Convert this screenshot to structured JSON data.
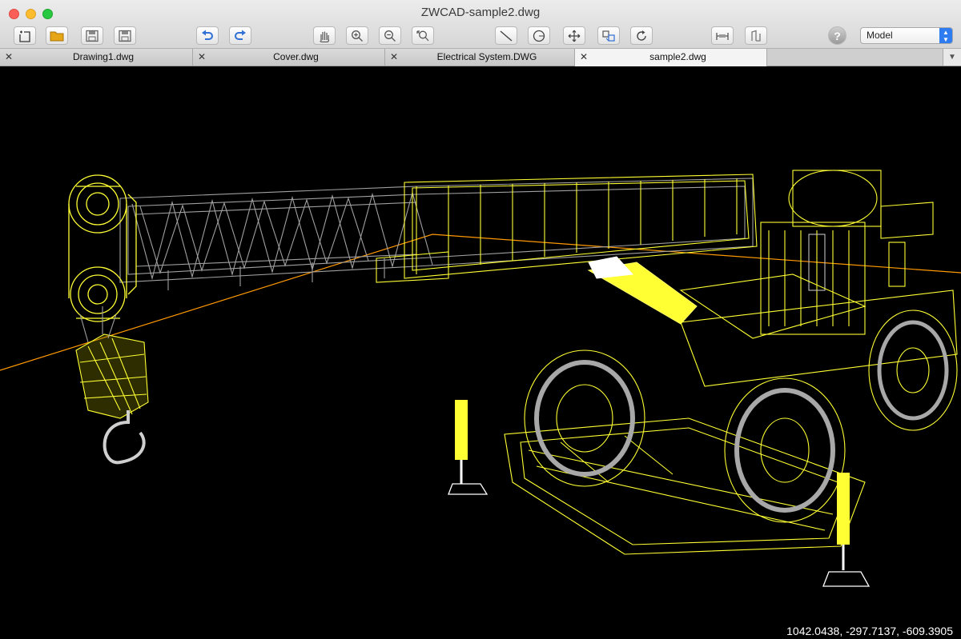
{
  "window": {
    "title": "ZWCAD-sample2.dwg"
  },
  "toolbar": {
    "buttons": [
      {
        "name": "new-drawing",
        "icon": "new-file-icon"
      },
      {
        "name": "open",
        "icon": "folder-icon"
      },
      {
        "name": "save",
        "icon": "floppy-disk-icon"
      },
      {
        "name": "save-as",
        "icon": "floppy-disk-pen-icon"
      },
      {
        "name": "undo",
        "icon": "undo-arrow-icon"
      },
      {
        "name": "redo",
        "icon": "redo-arrow-icon"
      },
      {
        "name": "pan",
        "icon": "hand-icon"
      },
      {
        "name": "zoom-in",
        "icon": "zoom-in-icon"
      },
      {
        "name": "zoom-out",
        "icon": "zoom-out-icon"
      },
      {
        "name": "zoom-extents",
        "icon": "zoom-window-icon"
      },
      {
        "name": "line",
        "icon": "line-icon"
      },
      {
        "name": "circle",
        "icon": "circle-icon"
      },
      {
        "name": "move",
        "icon": "move-arrows-icon"
      },
      {
        "name": "copy",
        "icon": "copy-icon"
      },
      {
        "name": "rotate",
        "icon": "rotate-icon"
      },
      {
        "name": "dimension",
        "icon": "dimension-icon"
      },
      {
        "name": "layer",
        "icon": "layer-icon"
      },
      {
        "name": "help",
        "icon": "question-mark-icon"
      }
    ],
    "space_select": {
      "selected": "Model"
    }
  },
  "tabs": [
    {
      "label": "Drawing1.dwg",
      "active": false
    },
    {
      "label": "Cover.dwg",
      "active": false
    },
    {
      "label": "Electrical System.DWG",
      "active": false
    },
    {
      "label": "sample2.dwg",
      "active": true
    }
  ],
  "viewport": {
    "background": "#000000",
    "model_color_primary": "#ffff00",
    "model_color_secondary": "#c0c0c0",
    "axis_color": "#ff9900",
    "coordinates": "1042.0438, -297.7137, -609.3905"
  }
}
